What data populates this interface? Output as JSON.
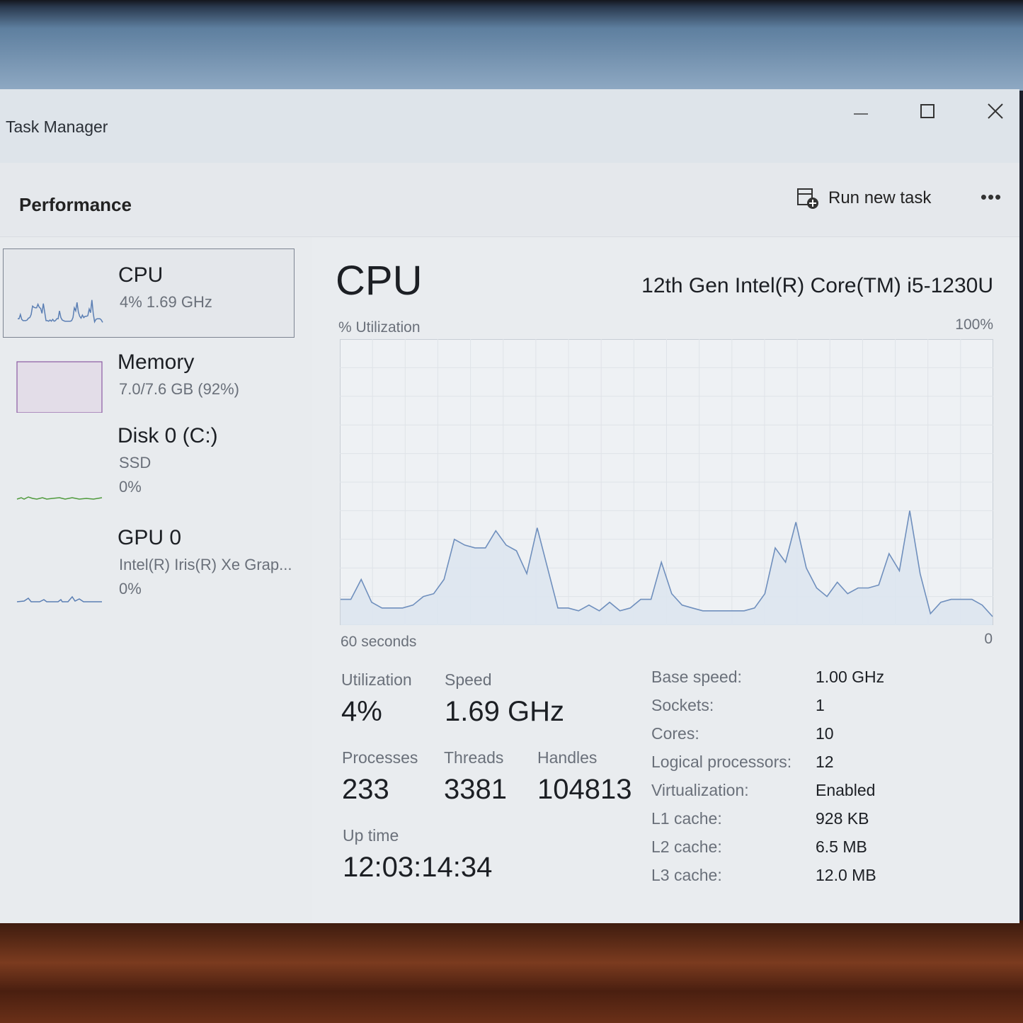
{
  "window": {
    "title": "Task Manager"
  },
  "header": {
    "section_title": "Performance",
    "run_new_task_label": "Run new task",
    "more_label": "•••"
  },
  "sidebar": {
    "items": [
      {
        "name": "CPU",
        "sub1": "4%  1.69 GHz",
        "sub2": "",
        "color": "#5b7fb4"
      },
      {
        "name": "Memory",
        "sub1": "7.0/7.6 GB (92%)",
        "sub2": "",
        "color": "#8c5aa3"
      },
      {
        "name": "Disk 0 (C:)",
        "sub1": "SSD",
        "sub2": "0%",
        "color": "#4f9a3c"
      },
      {
        "name": "GPU 0",
        "sub1": "Intel(R) Iris(R) Xe Grap...",
        "sub2": "0%",
        "color": "#5b7fb4"
      }
    ]
  },
  "main": {
    "title": "CPU",
    "model": "12th Gen Intel(R) Core(TM) i5-1230U",
    "util_label": "% Utilization",
    "util_max": "100%",
    "axis_left": "60 seconds",
    "axis_right": "0",
    "stats": {
      "utilization": {
        "label": "Utilization",
        "value": "4%"
      },
      "speed": {
        "label": "Speed",
        "value": "1.69 GHz"
      },
      "processes": {
        "label": "Processes",
        "value": "233"
      },
      "threads": {
        "label": "Threads",
        "value": "3381"
      },
      "handles": {
        "label": "Handles",
        "value": "104813"
      },
      "uptime": {
        "label": "Up time",
        "value": "12:03:14:34"
      }
    },
    "specs": [
      {
        "key": "Base speed:",
        "value": "1.00 GHz"
      },
      {
        "key": "Sockets:",
        "value": "1"
      },
      {
        "key": "Cores:",
        "value": "10"
      },
      {
        "key": "Logical processors:",
        "value": "12"
      },
      {
        "key": "Virtualization:",
        "value": "Enabled"
      },
      {
        "key": "L1 cache:",
        "value": "928 KB"
      },
      {
        "key": "L2 cache:",
        "value": "6.5 MB"
      },
      {
        "key": "L3 cache:",
        "value": "12.0 MB"
      }
    ]
  },
  "colors": {
    "cpu_line": "#6f8fbd",
    "cpu_fill": "#dde5ef",
    "grid": "#dfe3e8"
  },
  "chart_data": {
    "type": "area",
    "x_range_seconds": [
      60,
      0
    ],
    "ylim": [
      0,
      100
    ],
    "series": [
      {
        "values": [
          9,
          9,
          16,
          8,
          6,
          6,
          6,
          7,
          10,
          11,
          16,
          30,
          28,
          27,
          27,
          33,
          28,
          26,
          18,
          34,
          20,
          6,
          6,
          5,
          7,
          5,
          8,
          5,
          6,
          9,
          9,
          22,
          11,
          7,
          6,
          5,
          5,
          5,
          5,
          5,
          6,
          11,
          27,
          22,
          36,
          20,
          13,
          10,
          15,
          11,
          13,
          13,
          14,
          25,
          19,
          40,
          18,
          4,
          8,
          9,
          9,
          9,
          7,
          3
        ]
      }
    ]
  }
}
